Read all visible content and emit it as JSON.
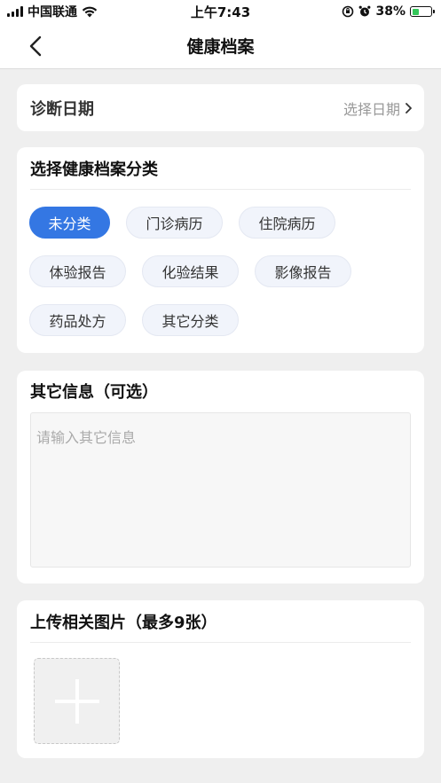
{
  "status_bar": {
    "carrier": "中国联通",
    "time": "上午7:43",
    "battery_percent": "38%",
    "battery_level": 0.38
  },
  "nav": {
    "title": "健康档案"
  },
  "diagnosis_date": {
    "label": "诊断日期",
    "picker_text": "选择日期"
  },
  "category": {
    "title": "选择健康档案分类",
    "options": [
      "未分类",
      "门诊病历",
      "住院病历",
      "体验报告",
      "化验结果",
      "影像报告",
      "药品处方",
      "其它分类"
    ],
    "selected": "未分类"
  },
  "other_info": {
    "title": "其它信息（可选）",
    "placeholder": "请输入其它信息"
  },
  "upload": {
    "title": "上传相关图片（最多9张）"
  },
  "colors": {
    "accent": "#3477e3",
    "chip_bg": "#f1f4fb",
    "page_bg": "#efefef",
    "battery_fill": "#34c759"
  }
}
